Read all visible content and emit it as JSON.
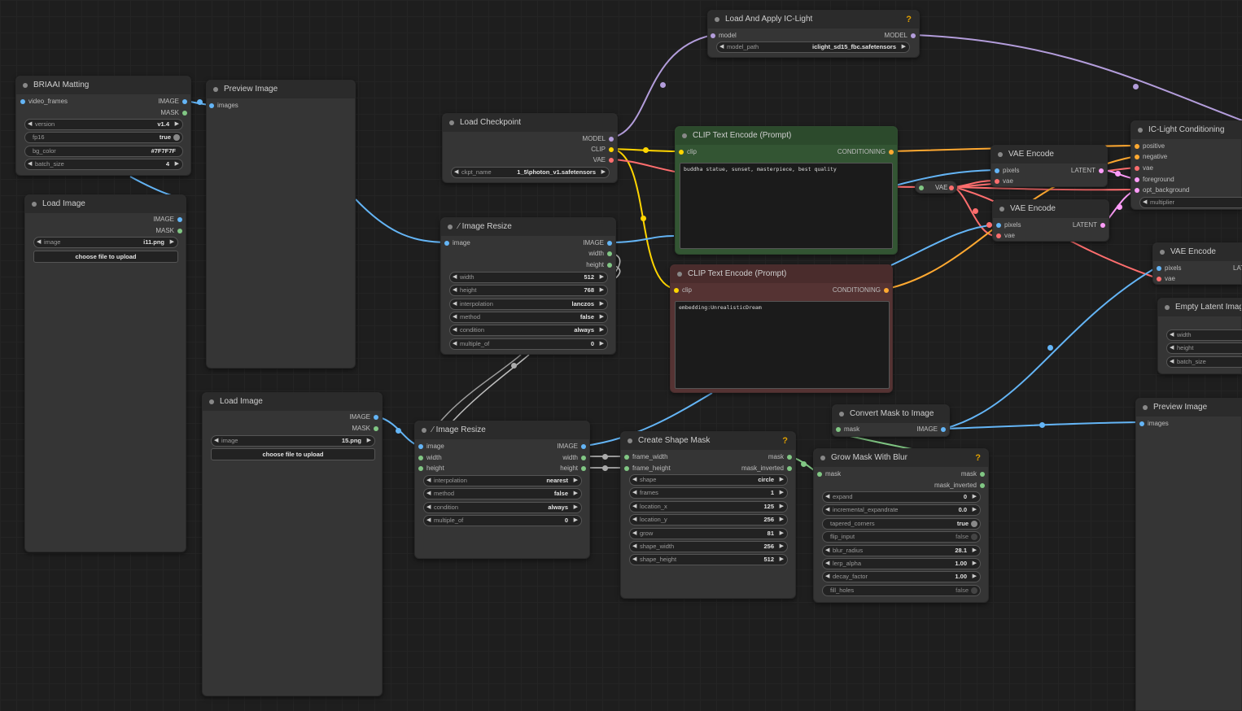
{
  "colors": {
    "image": "#64b5f6",
    "mask": "#81c784",
    "model": "#b39ddb",
    "clip": "#ffd500",
    "vae": "#ff6e6e",
    "conditioning": "#ffa931",
    "latent": "#ff9cf9",
    "int": "#81c784"
  },
  "nodes": {
    "briaai": {
      "title": "BRIAAI Matting",
      "in_frames": "video_frames",
      "out_image": "IMAGE",
      "out_mask": "MASK",
      "w_version": {
        "label": "version",
        "value": "v1.4"
      },
      "w_fp16": {
        "label": "fp16",
        "value": "true"
      },
      "w_bg": {
        "label": "bg_color",
        "value": "#7F7F7F"
      },
      "w_batch": {
        "label": "batch_size",
        "value": "4"
      }
    },
    "preview1": {
      "title": "Preview Image",
      "in_images": "images"
    },
    "load_image1": {
      "title": "Load Image",
      "out_image": "IMAGE",
      "out_mask": "MASK",
      "w_image": {
        "label": "image",
        "value": "i11.png"
      },
      "upload": "choose file to upload"
    },
    "load_image2": {
      "title": "Load Image",
      "out_image": "IMAGE",
      "out_mask": "MASK",
      "w_image": {
        "label": "image",
        "value": "15.png"
      },
      "upload": "choose file to upload"
    },
    "load_ckpt": {
      "title": "Load Checkpoint",
      "out_model": "MODEL",
      "out_clip": "CLIP",
      "out_vae": "VAE",
      "w_ckpt": {
        "label": "ckpt_name",
        "value": "1_5\\photon_v1.safetensors"
      }
    },
    "iclight_load": {
      "title": "Load And Apply IC-Light",
      "help": "?",
      "in_model": "model",
      "out_model": "MODEL",
      "w_path": {
        "label": "model_path",
        "value": "iclight_sd15_fbc.safetensors"
      }
    },
    "resize1": {
      "title": "Image Resize",
      "in_image": "image",
      "out_image": "IMAGE",
      "out_width": "width",
      "out_height": "height",
      "w_width": {
        "label": "width",
        "value": "512"
      },
      "w_height": {
        "label": "height",
        "value": "768"
      },
      "w_interp": {
        "label": "interpolation",
        "value": "lanczos"
      },
      "w_method": {
        "label": "method",
        "value": "false"
      },
      "w_cond": {
        "label": "condition",
        "value": "always"
      },
      "w_mult": {
        "label": "multiple_of",
        "value": "0"
      }
    },
    "resize2": {
      "title": "Image Resize",
      "in_image": "image",
      "in_width": "width",
      "in_height": "height",
      "out_image": "IMAGE",
      "out_width": "width",
      "out_height": "height",
      "w_interp": {
        "label": "interpolation",
        "value": "nearest"
      },
      "w_method": {
        "label": "method",
        "value": "false"
      },
      "w_cond": {
        "label": "condition",
        "value": "always"
      },
      "w_mult": {
        "label": "multiple_of",
        "value": "0"
      }
    },
    "clip_pos": {
      "title": "CLIP Text Encode (Prompt)",
      "in_clip": "clip",
      "out_cond": "CONDITIONING",
      "text": "buddha statue, sunset, masterpiece, best quality"
    },
    "clip_neg": {
      "title": "CLIP Text Encode (Prompt)",
      "in_clip": "clip",
      "out_cond": "CONDITIONING",
      "text": "embedding:UnrealisticDream"
    },
    "vae_encode1": {
      "title": "VAE Encode",
      "in_pixels": "pixels",
      "in_vae": "vae",
      "out_latent": "LATENT"
    },
    "vae_encode2": {
      "title": "VAE Encode",
      "in_pixels": "pixels",
      "in_vae": "vae",
      "out_latent": "LATENT"
    },
    "vae_encode3": {
      "title": "VAE Encode",
      "in_pixels": "pixels",
      "in_vae": "vae",
      "out_latent": "LAT"
    },
    "reroute": {
      "label": "VAE"
    },
    "iclight_cond": {
      "title": "IC-Light Conditioning",
      "in_pos": "positive",
      "in_neg": "negative",
      "in_vae": "vae",
      "in_fg": "foreground",
      "in_bg": "opt_background",
      "w_mult": "multiplier"
    },
    "empty_latent": {
      "title": "Empty Latent Image",
      "w_width": "width",
      "w_height": "height",
      "w_batch": "batch_size"
    },
    "preview2": {
      "title": "Preview Image",
      "in_images": "images"
    },
    "mask_to_image": {
      "title": "Convert Mask to Image",
      "in_mask": "mask",
      "out_image": "IMAGE"
    },
    "shape_mask": {
      "title": "Create Shape Mask",
      "help": "?",
      "in_fw": "frame_width",
      "in_fh": "frame_height",
      "out_mask": "mask",
      "out_inv": "mask_inverted",
      "w_shape": {
        "label": "shape",
        "value": "circle"
      },
      "w_frames": {
        "label": "frames",
        "value": "1"
      },
      "w_lx": {
        "label": "location_x",
        "value": "125"
      },
      "w_ly": {
        "label": "location_y",
        "value": "256"
      },
      "w_grow": {
        "label": "grow",
        "value": "81"
      },
      "w_sw": {
        "label": "shape_width",
        "value": "256"
      },
      "w_sh": {
        "label": "shape_height",
        "value": "512"
      }
    },
    "grow_mask": {
      "title": "Grow Mask With Blur",
      "help": "?",
      "in_mask": "mask",
      "out_mask": "mask",
      "out_inv": "mask_inverted",
      "w_expand": {
        "label": "expand",
        "value": "0"
      },
      "w_incr": {
        "label": "incremental_expandrate",
        "value": "0.0"
      },
      "w_taper": {
        "label": "tapered_corners",
        "value": "true"
      },
      "w_flip": {
        "label": "flip_input",
        "value": "false"
      },
      "w_blur": {
        "label": "blur_radius",
        "value": "28.1"
      },
      "w_lerp": {
        "label": "lerp_alpha",
        "value": "1.00"
      },
      "w_decay": {
        "label": "decay_factor",
        "value": "1.00"
      },
      "w_fill": {
        "label": "fill_holes",
        "value": "false"
      }
    }
  }
}
